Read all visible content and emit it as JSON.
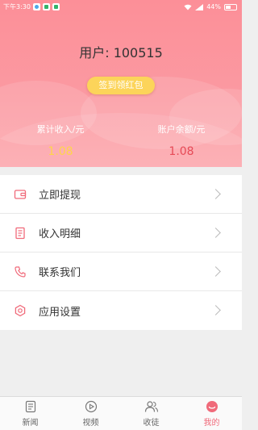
{
  "status_bar": {
    "time": "下午3:30",
    "battery": "44%"
  },
  "header": {
    "user_title": "用户: 100515",
    "checkin_button": "签到领红包",
    "total_income_label": "累计收入/元",
    "total_income_value": "1.08",
    "balance_label": "账户余额/元",
    "balance_value": "1.08"
  },
  "menu": {
    "items": [
      {
        "label": "立即提现",
        "icon": "wallet-icon"
      },
      {
        "label": "收入明细",
        "icon": "document-icon"
      },
      {
        "label": "联系我们",
        "icon": "phone-icon"
      },
      {
        "label": "应用设置",
        "icon": "settings-icon"
      }
    ]
  },
  "tabbar": {
    "tabs": [
      {
        "label": "新闻",
        "icon": "news-icon"
      },
      {
        "label": "视频",
        "icon": "video-icon"
      },
      {
        "label": "收徒",
        "icon": "people-icon"
      },
      {
        "label": "我的",
        "icon": "profile-icon",
        "active": true
      }
    ]
  },
  "colors": {
    "accent": "#f06a7a",
    "header": "#fc9aa2",
    "button": "#fcd45a",
    "income": "#ffd54a",
    "balance": "#e64a56"
  }
}
